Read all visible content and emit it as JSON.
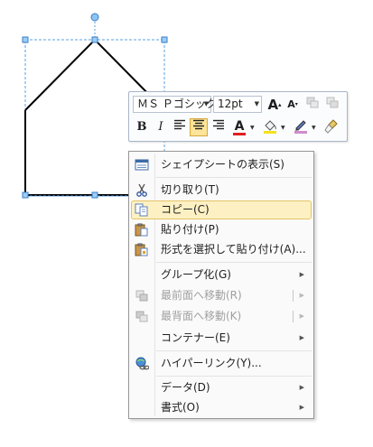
{
  "mini_toolbar": {
    "font_name": "ＭＳ Ｐゴシック",
    "font_size": "12pt",
    "grow_font_icon": "A",
    "shrink_font_icon": "A",
    "bold": "B",
    "italic": "I",
    "font_color_icon": "A"
  },
  "colors": {
    "highlight_bg": "#fdf1c4",
    "highlight_border": "#e5c365",
    "font_color_bar": "#e02020",
    "fill_color_bar": "#f5e11c",
    "line_color_bar": "#d08ccc",
    "selection_handle": "#5aa0e6"
  },
  "menu": {
    "items": [
      {
        "label": "シェイプシートの表示(S)",
        "icon": "shapesheet-icon"
      },
      {
        "label": "切り取り(T)",
        "icon": "scissors-icon"
      },
      {
        "label": "コピー(C)",
        "icon": "copy-icon"
      },
      {
        "label": "貼り付け(P)",
        "icon": "paste-icon"
      },
      {
        "label": "形式を選択して貼り付け(A)...",
        "icon": "paste-special-icon"
      },
      {
        "label": "グループ化(G)",
        "submenu": true
      },
      {
        "label": "最前面へ移動(R)",
        "icon": "bring-front-icon",
        "disabled": true,
        "submenu": true
      },
      {
        "label": "最背面へ移動(K)",
        "icon": "send-back-icon",
        "disabled": true,
        "submenu": true
      },
      {
        "label": "コンテナー(E)",
        "submenu": true
      },
      {
        "label": "ハイパーリンク(Y)...",
        "icon": "hyperlink-icon"
      },
      {
        "label": "データ(D)",
        "submenu": true
      },
      {
        "label": "書式(O)",
        "submenu": true
      }
    ]
  }
}
